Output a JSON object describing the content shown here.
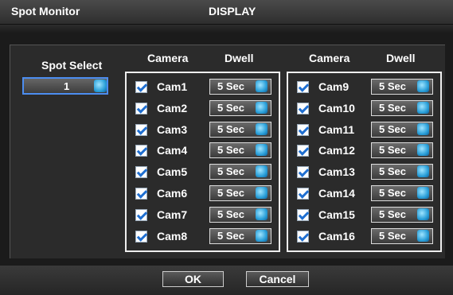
{
  "window": {
    "title": "Spot Monitor",
    "header": "DISPLAY"
  },
  "spot_select": {
    "label": "Spot Select",
    "value": "1"
  },
  "columns": {
    "camera": "Camera",
    "dwell": "Dwell"
  },
  "cameras_left": [
    {
      "name": "Cam1",
      "dwell": "5 Sec",
      "checked": true
    },
    {
      "name": "Cam2",
      "dwell": "5 Sec",
      "checked": true
    },
    {
      "name": "Cam3",
      "dwell": "5 Sec",
      "checked": true
    },
    {
      "name": "Cam4",
      "dwell": "5 Sec",
      "checked": true
    },
    {
      "name": "Cam5",
      "dwell": "5 Sec",
      "checked": true
    },
    {
      "name": "Cam6",
      "dwell": "5 Sec",
      "checked": true
    },
    {
      "name": "Cam7",
      "dwell": "5 Sec",
      "checked": true
    },
    {
      "name": "Cam8",
      "dwell": "5 Sec",
      "checked": true
    }
  ],
  "cameras_right": [
    {
      "name": "Cam9",
      "dwell": "5 Sec",
      "checked": true
    },
    {
      "name": "Cam10",
      "dwell": "5 Sec",
      "checked": true
    },
    {
      "name": "Cam11",
      "dwell": "5 Sec",
      "checked": true
    },
    {
      "name": "Cam12",
      "dwell": "5 Sec",
      "checked": true
    },
    {
      "name": "Cam13",
      "dwell": "5 Sec",
      "checked": true
    },
    {
      "name": "Cam14",
      "dwell": "5 Sec",
      "checked": true
    },
    {
      "name": "Cam15",
      "dwell": "5 Sec",
      "checked": true
    },
    {
      "name": "Cam16",
      "dwell": "5 Sec",
      "checked": true
    }
  ],
  "buttons": {
    "ok": "OK",
    "cancel": "Cancel"
  },
  "icons": {
    "cycle": "cycle-arrows-icon",
    "check": "checkbox-check-icon"
  },
  "colors": {
    "accent": "#4c8df0",
    "checkmark": "#1f6fd1"
  }
}
